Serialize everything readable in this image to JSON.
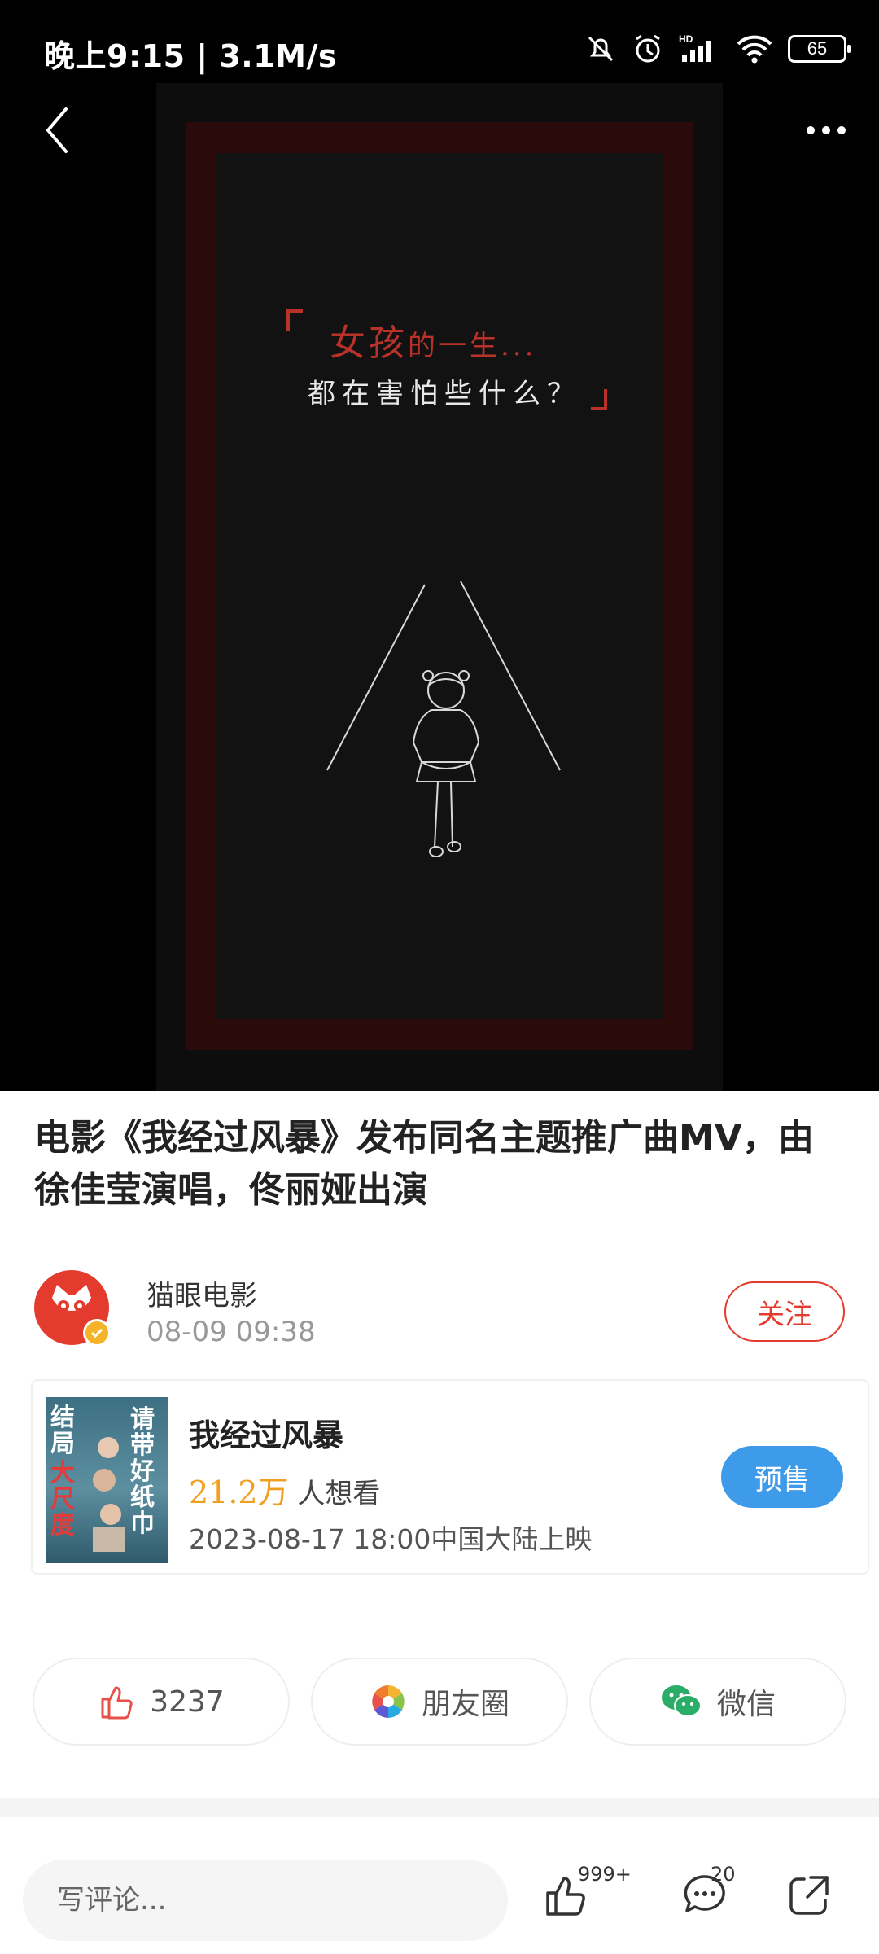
{
  "status_bar": {
    "time": "晚上9:15 | 3.1M/s",
    "battery": "65",
    "icons": [
      "mute-bell-icon",
      "alarm-icon",
      "hd-signal-icon",
      "wifi-icon",
      "battery-icon"
    ]
  },
  "video": {
    "caption_line1_big": "女孩",
    "caption_line1_small": "的一生...",
    "caption_line2": "都在害怕些什么？",
    "back_icon": "chevron-left-icon",
    "more_icon": "more-dots-icon"
  },
  "article": {
    "title": "电影《我经过风暴》发布同名主题推广曲MV，由徐佳莹演唱，佟丽娅出演"
  },
  "author": {
    "name": "猫眼电影",
    "time": "08-09 09:38",
    "follow_label": "关注"
  },
  "movie": {
    "title": "我经过风暴",
    "want_count": "21.2万",
    "want_suffix": " 人想看",
    "release": "2023-08-17 18:00中国大陆上映",
    "presale_label": "预售",
    "poster_text_1": "结局",
    "poster_text_2": "请带好纸巾",
    "poster_text_3": "大尺度"
  },
  "share": {
    "like_count": "3237",
    "moments_label": "朋友圈",
    "wechat_label": "微信"
  },
  "bottom": {
    "comment_placeholder": "写评论...",
    "like_badge": "999+",
    "comment_badge": "20"
  },
  "colors": {
    "accent_red": "#e33b2e",
    "presale_blue": "#3d9be9",
    "want_orange": "#f0a020"
  }
}
